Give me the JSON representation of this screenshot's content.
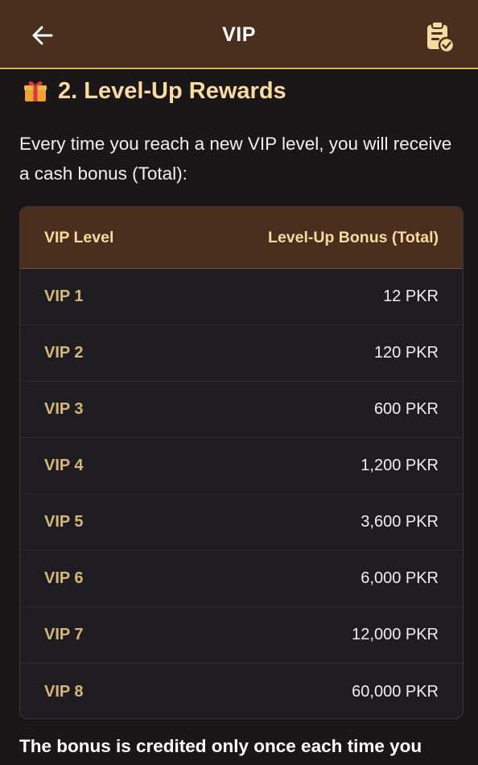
{
  "header": {
    "title": "VIP",
    "back_icon": "back-arrow-icon",
    "action_icon": "clipboard-check-icon"
  },
  "section": {
    "icon": "gift-icon",
    "title": "2. Level-Up Rewards",
    "intro": "Every time you reach a new VIP level, you will receive a cash bonus (Total):"
  },
  "table": {
    "columns": [
      "VIP Level",
      "Level-Up Bonus (Total)"
    ],
    "rows": [
      {
        "level": "VIP 1",
        "bonus": "12 PKR"
      },
      {
        "level": "VIP 2",
        "bonus": "120 PKR"
      },
      {
        "level": "VIP 3",
        "bonus": "600 PKR"
      },
      {
        "level": "VIP 4",
        "bonus": "1,200 PKR"
      },
      {
        "level": "VIP 5",
        "bonus": "3,600 PKR"
      },
      {
        "level": "VIP 6",
        "bonus": "6,000 PKR"
      },
      {
        "level": "VIP 7",
        "bonus": "12,000 PKR"
      },
      {
        "level": "VIP 8",
        "bonus": "60,000 PKR"
      }
    ]
  },
  "footnote": "The bonus is credited only once each time you",
  "colors": {
    "header_bg": "#4a2e1e",
    "accent_gold": "#f6dca0",
    "level_text": "#d6b77a",
    "page_bg": "#1b1719"
  }
}
